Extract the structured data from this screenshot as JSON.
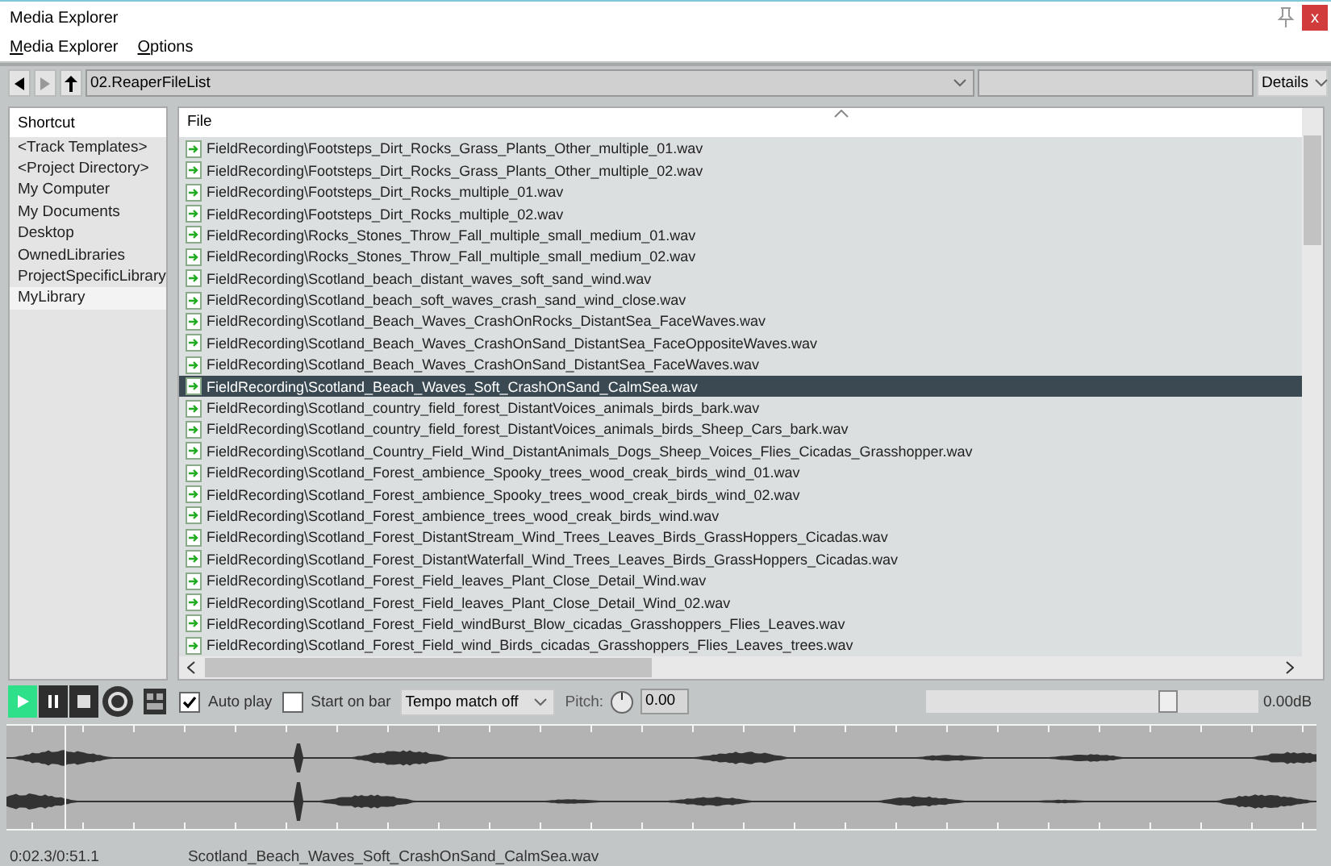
{
  "window": {
    "title": "Media Explorer",
    "close": "x"
  },
  "menu": [
    "Media Explorer",
    "Options"
  ],
  "toolbar": {
    "path": "02.ReaperFileList",
    "view": "Details"
  },
  "sidebar": {
    "header": "Shortcut",
    "items": [
      {
        "label": "<Track Templates>",
        "selected": false
      },
      {
        "label": "<Project Directory>",
        "selected": false
      },
      {
        "label": "My Computer",
        "selected": false
      },
      {
        "label": "My Documents",
        "selected": false
      },
      {
        "label": "Desktop",
        "selected": false
      },
      {
        "label": "OwnedLibraries",
        "selected": false
      },
      {
        "label": "ProjectSpecificLibrary",
        "selected": false
      },
      {
        "label": "MyLibrary",
        "selected": true
      }
    ]
  },
  "table": {
    "columns": [
      "File"
    ],
    "rows": [
      {
        "file": "FieldRecording\\Footsteps_Dirt_Rocks_Grass_Plants_Other_multiple_01.wav",
        "selected": false
      },
      {
        "file": "FieldRecording\\Footsteps_Dirt_Rocks_Grass_Plants_Other_multiple_02.wav",
        "selected": false
      },
      {
        "file": "FieldRecording\\Footsteps_Dirt_Rocks_multiple_01.wav",
        "selected": false
      },
      {
        "file": "FieldRecording\\Footsteps_Dirt_Rocks_multiple_02.wav",
        "selected": false
      },
      {
        "file": "FieldRecording\\Rocks_Stones_Throw_Fall_multiple_small_medium_01.wav",
        "selected": false
      },
      {
        "file": "FieldRecording\\Rocks_Stones_Throw_Fall_multiple_small_medium_02.wav",
        "selected": false
      },
      {
        "file": "FieldRecording\\Scotland_beach_distant_waves_soft_sand_wind.wav",
        "selected": false
      },
      {
        "file": "FieldRecording\\Scotland_beach_soft_waves_crash_sand_wind_close.wav",
        "selected": false
      },
      {
        "file": "FieldRecording\\Scotland_Beach_Waves_CrashOnRocks_DistantSea_FaceWaves.wav",
        "selected": false
      },
      {
        "file": "FieldRecording\\Scotland_Beach_Waves_CrashOnSand_DistantSea_FaceOppositeWaves.wav",
        "selected": false
      },
      {
        "file": "FieldRecording\\Scotland_Beach_Waves_CrashOnSand_DistantSea_FaceWaves.wav",
        "selected": false
      },
      {
        "file": "FieldRecording\\Scotland_Beach_Waves_Soft_CrashOnSand_CalmSea.wav",
        "selected": true
      },
      {
        "file": "FieldRecording\\Scotland_country_field_forest_DistantVoices_animals_birds_bark.wav",
        "selected": false
      },
      {
        "file": "FieldRecording\\Scotland_country_field_forest_DistantVoices_animals_birds_Sheep_Cars_bark.wav",
        "selected": false
      },
      {
        "file": "FieldRecording\\Scotland_Country_Field_Wind_DistantAnimals_Dogs_Sheep_Voices_Flies_Cicadas_Grasshopper.wav",
        "selected": false
      },
      {
        "file": "FieldRecording\\Scotland_Forest_ambience_Spooky_trees_wood_creak_birds_wind_01.wav",
        "selected": false
      },
      {
        "file": "FieldRecording\\Scotland_Forest_ambience_Spooky_trees_wood_creak_birds_wind_02.wav",
        "selected": false
      },
      {
        "file": "FieldRecording\\Scotland_Forest_ambience_trees_wood_creak_birds_wind.wav",
        "selected": false
      },
      {
        "file": "FieldRecording\\Scotland_Forest_DistantStream_Wind_Trees_Leaves_Birds_GrassHoppers_Cicadas.wav",
        "selected": false
      },
      {
        "file": "FieldRecording\\Scotland_Forest_DistantWaterfall_Wind_Trees_Leaves_Birds_GrassHoppers_Cicadas.wav",
        "selected": false
      },
      {
        "file": "FieldRecording\\Scotland_Forest_Field_leaves_Plant_Close_Detail_Wind.wav",
        "selected": false
      },
      {
        "file": "FieldRecording\\Scotland_Forest_Field_leaves_Plant_Close_Detail_Wind_02.wav",
        "selected": false
      },
      {
        "file": "FieldRecording\\Scotland_Forest_Field_windBurst_Blow_cicadas_Grasshoppers_Flies_Leaves.wav",
        "selected": false
      },
      {
        "file": "FieldRecording\\Scotland_Forest_Field_wind_Birds_cicadas_Grasshoppers_Flies_Leaves_trees.wav",
        "selected": false
      }
    ]
  },
  "transport": {
    "play_active": true,
    "auto_play": {
      "label": "Auto play",
      "checked": true
    },
    "start_on_bar": {
      "label": "Start on bar",
      "checked": false
    },
    "tempo_match": "Tempo match off",
    "pitch_label": "Pitch:",
    "pitch": "0.00",
    "volume": {
      "level": 0.73,
      "reading": "0.00dB"
    }
  },
  "status": {
    "time": "0:02.3/0:51.1",
    "file": "Scotland_Beach_Waves_Soft_CrashOnSand_CalmSea.wav"
  }
}
